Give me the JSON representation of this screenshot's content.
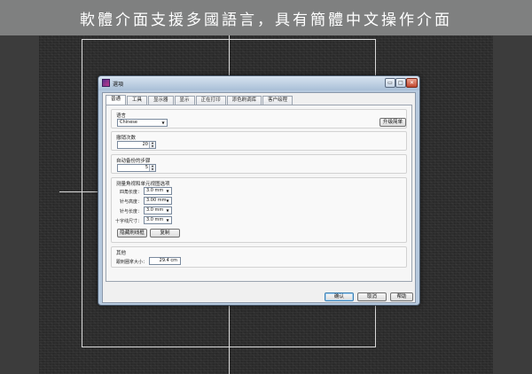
{
  "banner": {
    "text": "軟體介面支援多國語言，具有簡體中文操作介面"
  },
  "dialog": {
    "title": "選項",
    "window_buttons": {
      "minimize": "▭",
      "maximize": "□",
      "close": "✕"
    },
    "tabs": [
      {
        "label": "普通",
        "active": true
      },
      {
        "label": "工具"
      },
      {
        "label": "显示器"
      },
      {
        "label": "显示"
      },
      {
        "label": "正在打印"
      },
      {
        "label": "添色刷调库"
      },
      {
        "label": "客户绘程"
      }
    ],
    "language": {
      "title": "语言",
      "selected": "Chinese",
      "button": "升级简单"
    },
    "undo": {
      "title": "撤销次数",
      "value": "20"
    },
    "autosave": {
      "title": "自动备份的步骤",
      "value": "5"
    },
    "measure": {
      "title": "测量角视和单元视图选项",
      "rows": [
        {
          "label": "四角长度：",
          "value": "3.0 mm"
        },
        {
          "label": "针与高度：",
          "value": "3.00 mm"
        },
        {
          "label": "针与长度：",
          "value": "3.0 mm"
        },
        {
          "label": "十字线尺寸：",
          "value": "3.0 mm"
        }
      ],
      "buttons": {
        "hide": "隐藏刷线框",
        "reset": "复制"
      }
    },
    "other": {
      "title": "其他",
      "label": "跟刺圈拿大小：",
      "value": "29.4 cm"
    },
    "footer": {
      "ok": "确认",
      "cancel": "取消",
      "help": "帮助"
    }
  },
  "colors": {
    "banner_bg": "#7f8080",
    "page_bg": "#3c3c3c",
    "dialog_frame": "#b6c9de",
    "guide_line": "#d9d9d9"
  }
}
